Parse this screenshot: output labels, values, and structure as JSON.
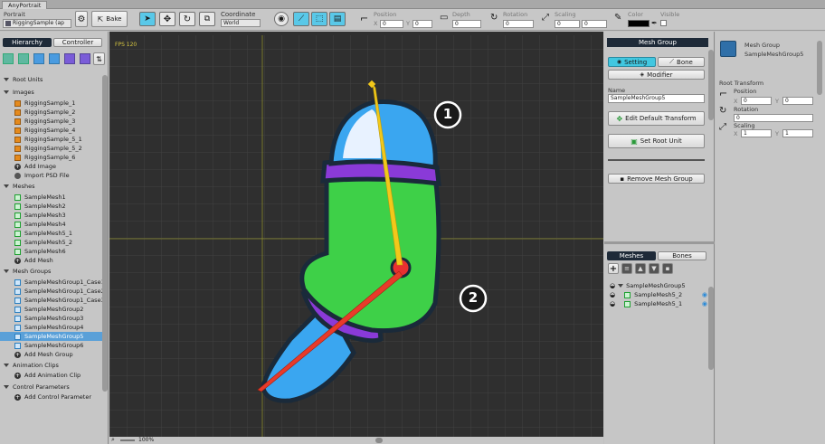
{
  "window": {
    "title": "AnyPortrait"
  },
  "toolbar": {
    "portrait_label": "Portrait",
    "portrait_value": "RiggingSample (ap",
    "bake_label": "Bake",
    "coordinate_label": "Coordinate",
    "coordinate_value": "World",
    "position_label": "Position",
    "depth_label": "Depth",
    "rotation_label": "Rotation",
    "scaling_label": "Scaling",
    "color_label": "Color",
    "visible_label": "Visible",
    "x_label": "X",
    "y_label": "Y",
    "pos_x": "0",
    "pos_y": "0",
    "depth": "0",
    "rotation": "0",
    "scale_x": "0",
    "scale_y": "0",
    "color_value": "#000000"
  },
  "left_panel": {
    "tab_hierarchy": "Hierarchy",
    "tab_controller": "Controller",
    "sections": {
      "root_units": "Root Units",
      "images": "Images",
      "meshes": "Meshes",
      "mesh_groups": "Mesh Groups",
      "animation_clips": "Animation Clips",
      "control_parameters": "Control Parameters"
    },
    "images": [
      "RiggingSample_1",
      "RiggingSample_2",
      "RiggingSample_3",
      "RiggingSample_4",
      "RiggingSample_5_1",
      "RiggingSample_5_2",
      "RiggingSample_6"
    ],
    "add_image": "Add Image",
    "import_psd": "Import PSD File",
    "meshes": [
      "SampleMesh1",
      "SampleMesh2",
      "SampleMesh3",
      "SampleMesh4",
      "SampleMesh5_1",
      "SampleMesh5_2",
      "SampleMesh6"
    ],
    "add_mesh": "Add Mesh",
    "mesh_groups": [
      "SampleMeshGroup1_Case1",
      "SampleMeshGroup1_Case2",
      "SampleMeshGroup1_Case3",
      "SampleMeshGroup2",
      "SampleMeshGroup3",
      "SampleMeshGroup4",
      "SampleMeshGroup5",
      "SampleMeshGroup6"
    ],
    "selected_mesh_group_index": 6,
    "add_mesh_group": "Add Mesh Group",
    "add_animation_clip": "Add Animation Clip",
    "add_control_parameter": "Add Control Parameter"
  },
  "viewport": {
    "fps": "FPS 120",
    "zoom": "100%",
    "callout_1": "1",
    "callout_2": "2",
    "grid_color": "#444444",
    "bg_color": "#2f2f2f"
  },
  "mesh_group_panel": {
    "header": "Mesh Group",
    "tab_setting": "Setting",
    "tab_bone": "Bone",
    "modifier": "Modifier",
    "name_label": "Name",
    "name_value": "SampleMeshGroup5",
    "edit_default_transform": "Edit Default Transform",
    "set_root_unit": "Set Root Unit",
    "remove_mesh_group": "Remove Mesh Group",
    "tab_meshes": "Meshes",
    "tab_bones": "Bones",
    "tree_root": "SampleMeshGroup5",
    "tree_children": [
      "SampleMesh5_2",
      "SampleMesh5_1"
    ]
  },
  "inspector": {
    "type": "Mesh Group",
    "name": "SampleMeshGroup5",
    "root_transform": "Root Transform",
    "position_label": "Position",
    "pos_x": "0",
    "pos_y": "0",
    "rotation_label": "Rotation",
    "rotation": "0",
    "scaling_label": "Scaling",
    "scale_x": "1",
    "scale_y": "1",
    "x_label": "X",
    "y_label": "Y"
  }
}
